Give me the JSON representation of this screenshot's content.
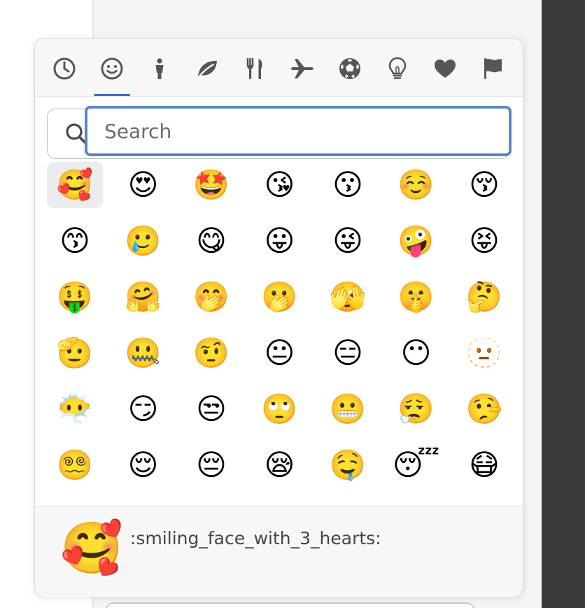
{
  "picker": {
    "tabs": [
      {
        "name": "tab-recent",
        "icon": "clock-icon",
        "active": false
      },
      {
        "name": "tab-smileys",
        "icon": "smiley-icon",
        "active": true
      },
      {
        "name": "tab-people",
        "icon": "person-icon",
        "active": false
      },
      {
        "name": "tab-nature",
        "icon": "leaf-icon",
        "active": false
      },
      {
        "name": "tab-food",
        "icon": "utensils-icon",
        "active": false
      },
      {
        "name": "tab-travel",
        "icon": "airplane-icon",
        "active": false
      },
      {
        "name": "tab-activities",
        "icon": "soccer-ball-icon",
        "active": false
      },
      {
        "name": "tab-objects",
        "icon": "lightbulb-icon",
        "active": false
      },
      {
        "name": "tab-symbols",
        "icon": "heart-icon",
        "active": false
      },
      {
        "name": "tab-flags",
        "icon": "flag-icon",
        "active": false
      }
    ],
    "accent_color": "#3b6bc4",
    "search": {
      "placeholder": "Search",
      "value": ""
    },
    "emojis": [
      [
        "🥰",
        "😍",
        "🤩",
        "😘",
        "😗",
        "☺️",
        "😚"
      ],
      [
        "😙",
        "🥲",
        "😋",
        "😛",
        "😜",
        "🤪",
        "😝"
      ],
      [
        "🤑",
        "🤗",
        "🤭",
        "🫢",
        "🫣",
        "🤫",
        "🤔"
      ],
      [
        "🫡",
        "🤐",
        "🤨",
        "😐",
        "😑",
        "😶",
        "🫥"
      ],
      [
        "😶‍🌫️",
        "😏",
        "😒",
        "🙄",
        "😬",
        "😮‍💨",
        "🤥"
      ],
      [
        "😵‍💫",
        "😌",
        "😔",
        "😪",
        "🤤",
        "😴",
        "😷"
      ]
    ],
    "selected": {
      "row": 0,
      "col": 0
    },
    "preview": {
      "emoji": "🥰",
      "shortcode": ":smiling_face_with_3_hearts:"
    }
  }
}
